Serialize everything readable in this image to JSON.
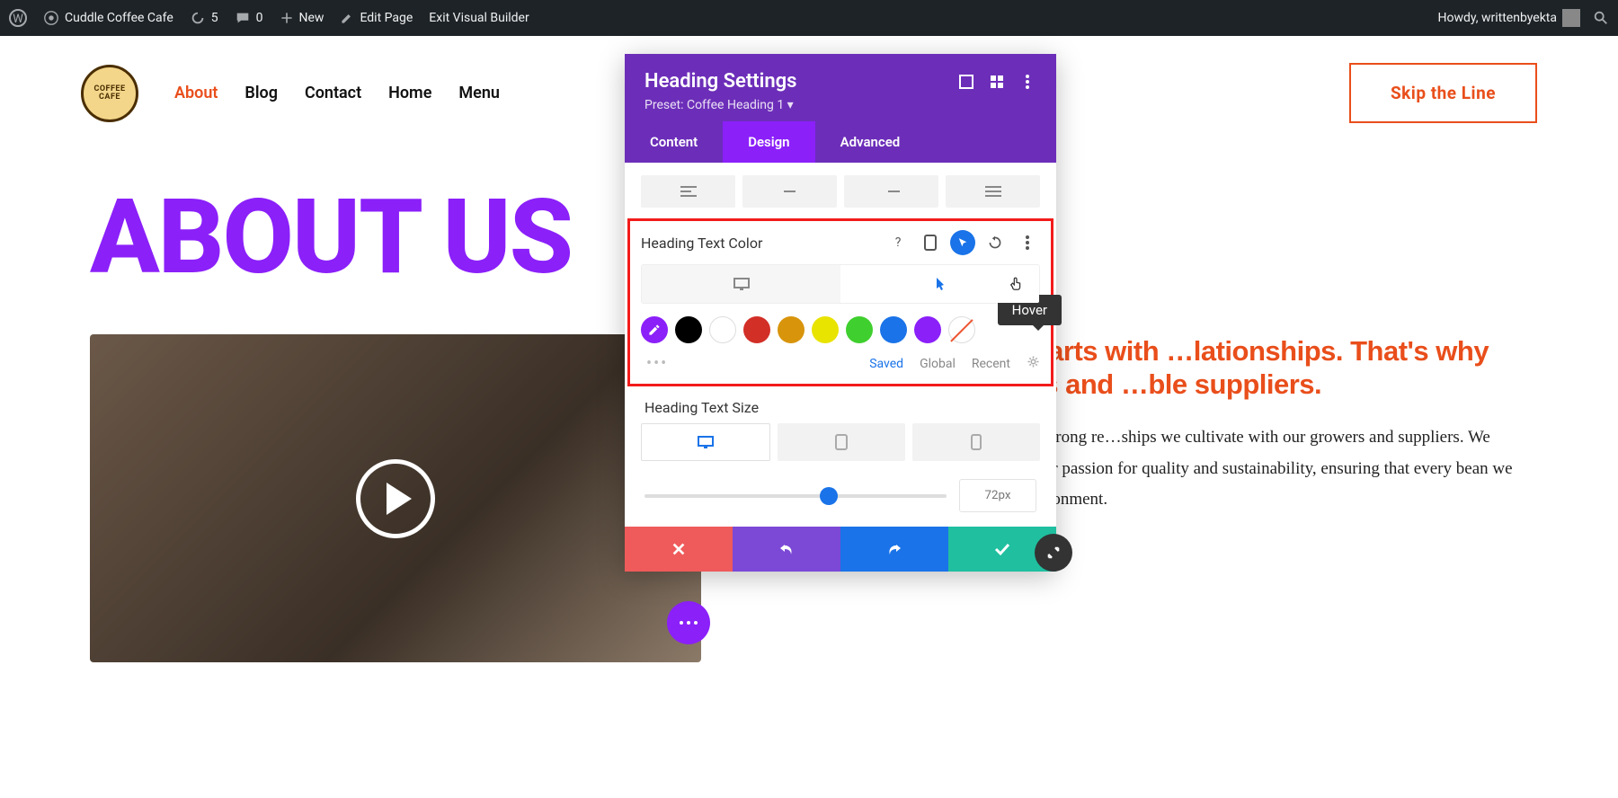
{
  "wp_bar": {
    "site": "Cuddle Coffee Cafe",
    "updates": "5",
    "comments": "0",
    "new": "New",
    "edit": "Edit Page",
    "exit": "Exit Visual Builder",
    "howdy": "Howdy, writtenbyekta"
  },
  "nav": {
    "items": [
      "About",
      "Blog",
      "Contact",
      "Home",
      "Menu"
    ],
    "active": 0
  },
  "cta": "Skip the Line",
  "hero_title": "ABOUT US",
  "blurb": "…eve that great coffee starts with …lationships. That's why we …with ethical growers and …ble suppliers.",
  "body_text": "…tment to exceptional coffee begins with the strong re…ships we cultivate with our growers and suppliers. We work closely with ethical farmers who share our passion for quality and sustainability, ensuring that every bean we use is grown with care and respect for the environment.",
  "panel": {
    "title": "Heading Settings",
    "preset": "Preset: Coffee Heading 1 ▾",
    "tabs": [
      "Content",
      "Design",
      "Advanced"
    ],
    "active_tab": 1,
    "opt_label": "Heading Text Color",
    "tooltip": "Hover",
    "swatch_palette": [
      "#000000",
      "#ffffff",
      "#d22f27",
      "#d8940b",
      "#e9e300",
      "#3fcf2e",
      "#1a73e8",
      "#8b20f9"
    ],
    "swatch_tabs": [
      "Saved",
      "Global",
      "Recent"
    ],
    "swatch_active": 0,
    "size_label": "Heading Text Size",
    "size_value": "72px"
  },
  "logo_text": "COFFEE CAFE"
}
